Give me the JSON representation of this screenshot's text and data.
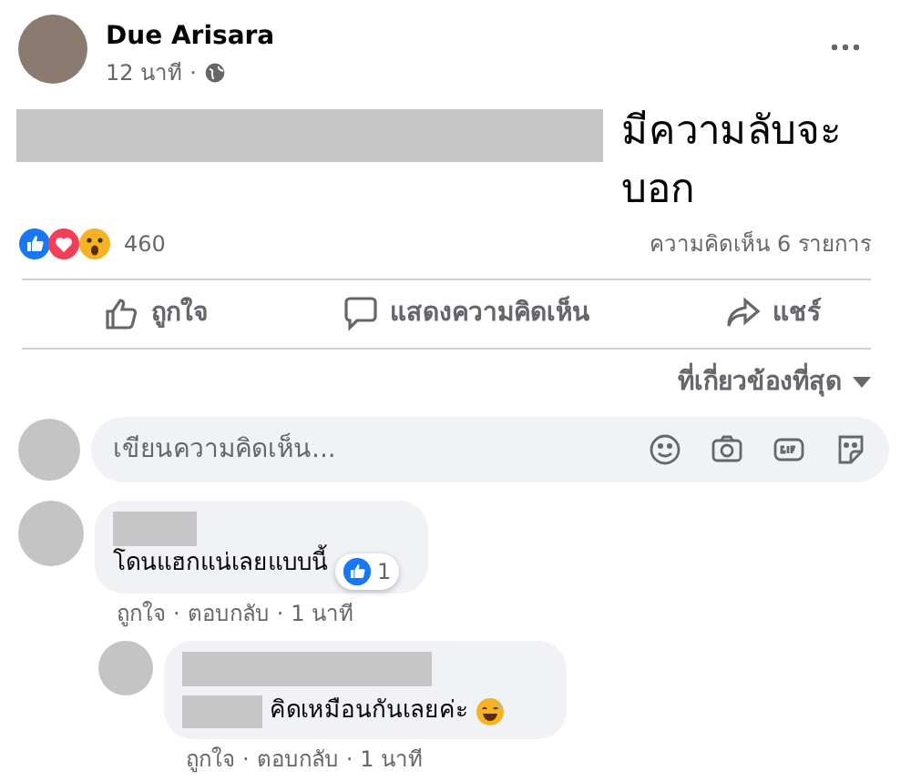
{
  "post": {
    "author": "Due Arisara",
    "time": "12 นาที",
    "separator": "·",
    "text": "มีความลับจะบอก",
    "reaction_count": "460",
    "comment_count": "ความคิดเห็น 6 รายการ",
    "actions": [
      {
        "label": "ถูกใจ",
        "kind": "like"
      },
      {
        "label": "แสดงความคิดเห็น",
        "kind": "comment"
      },
      {
        "label": "แชร์",
        "kind": "share"
      }
    ]
  },
  "sort": {
    "label": "ที่เกี่ยวข้องที่สุด"
  },
  "composer": {
    "placeholder": "เขียนความคิดเห็น..."
  },
  "comments": [
    {
      "text": "โดนแฮกแน่เลยแบบนี้",
      "like_count": "1",
      "like": "ถูกใจ",
      "reply": "ตอบกลับ",
      "time": "1 นาที",
      "replies": [
        {
          "text": "คิดเหมือนกันเลยค่ะ",
          "like": "ถูกใจ",
          "reply": "ตอบกลับ",
          "time": "1 นาที"
        }
      ]
    }
  ]
}
